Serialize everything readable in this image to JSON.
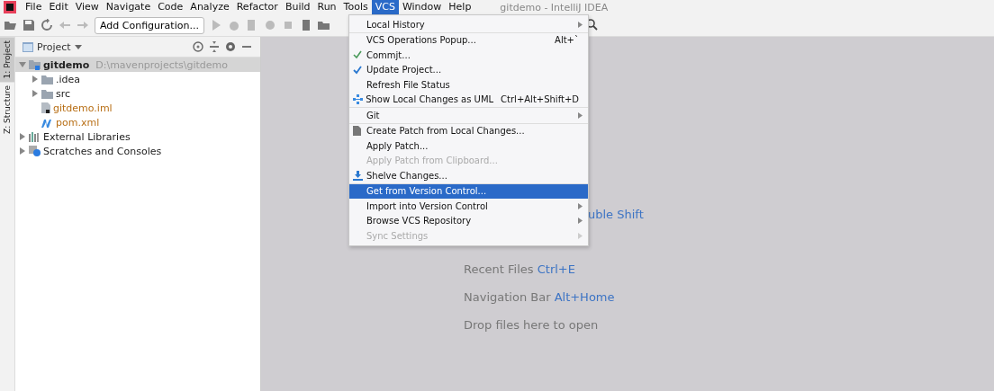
{
  "window": {
    "title": "gitdemo - IntelliJ IDEA"
  },
  "menubar": [
    {
      "label": "File",
      "selected": false
    },
    {
      "label": "Edit",
      "selected": false
    },
    {
      "label": "View",
      "selected": false
    },
    {
      "label": "Navigate",
      "selected": false
    },
    {
      "label": "Code",
      "selected": false
    },
    {
      "label": "Analyze",
      "selected": false
    },
    {
      "label": "Refactor",
      "selected": false
    },
    {
      "label": "Build",
      "selected": false
    },
    {
      "label": "Run",
      "selected": false
    },
    {
      "label": "Tools",
      "selected": false
    },
    {
      "label": "VCS",
      "selected": true
    },
    {
      "label": "Window",
      "selected": false
    },
    {
      "label": "Help",
      "selected": false
    }
  ],
  "toolbar": {
    "run_config": "Add Configuration..."
  },
  "side_tabs": [
    {
      "label": "1: Project",
      "selected": true
    },
    {
      "label": "Z: Structure",
      "selected": false
    }
  ],
  "project_panel": {
    "title": "Project",
    "tree": [
      {
        "label": "gitdemo",
        "path": "D:\\mavenprojects\\gitdemo",
        "expanded": true,
        "selected": true,
        "kind": "module",
        "children": [
          {
            "label": ".idea",
            "expanded": false,
            "selected": false,
            "kind": "folder"
          },
          {
            "label": "src",
            "expanded": false,
            "selected": false,
            "kind": "folder"
          },
          {
            "label": "gitdemo.iml",
            "selected": false,
            "kind": "iml"
          },
          {
            "label": "pom.xml",
            "selected": false,
            "kind": "maven"
          }
        ]
      },
      {
        "label": "External Libraries",
        "expanded": false,
        "selected": false,
        "kind": "libraries"
      },
      {
        "label": "Scratches and Consoles",
        "expanded": false,
        "selected": false,
        "kind": "scratches"
      }
    ]
  },
  "vcs_menu": [
    {
      "kind": "item",
      "label": "Local History",
      "submenu": true,
      "disabled": false,
      "selected": false
    },
    {
      "kind": "separator"
    },
    {
      "kind": "item",
      "label": "VCS Operations Popup...",
      "shortcut": "Alt+`",
      "submenu": false,
      "disabled": false,
      "selected": false
    },
    {
      "kind": "item",
      "label": "Commjt...",
      "submenu": false,
      "disabled": false,
      "selected": false
    },
    {
      "kind": "item",
      "label": "Update Project...",
      "submenu": false,
      "disabled": false,
      "selected": false
    },
    {
      "kind": "item",
      "label": "Refresh File Status",
      "submenu": false,
      "disabled": false,
      "selected": false
    },
    {
      "kind": "item",
      "label": "Show Local Changes as UML",
      "shortcut": "Ctrl+Alt+Shift+D",
      "submenu": false,
      "disabled": false,
      "selected": false
    },
    {
      "kind": "separator"
    },
    {
      "kind": "item",
      "label": "Git",
      "submenu": true,
      "disabled": false,
      "selected": false
    },
    {
      "kind": "separator"
    },
    {
      "kind": "item",
      "label": "Create Patch from Local Changes...",
      "submenu": false,
      "disabled": false,
      "selected": false
    },
    {
      "kind": "item",
      "label": "Apply Patch...",
      "submenu": false,
      "disabled": false,
      "selected": false
    },
    {
      "kind": "item",
      "label": "Apply Patch from Clipboard...",
      "submenu": false,
      "disabled": true,
      "selected": false
    },
    {
      "kind": "item",
      "label": "Shelve Changes...",
      "submenu": false,
      "disabled": false,
      "selected": false
    },
    {
      "kind": "separator"
    },
    {
      "kind": "item",
      "label": "Get from Version Control...",
      "submenu": false,
      "disabled": false,
      "selected": true
    },
    {
      "kind": "item",
      "label": "Import into Version Control",
      "submenu": true,
      "disabled": false,
      "selected": false
    },
    {
      "kind": "item",
      "label": "Browse VCS Repository",
      "submenu": true,
      "disabled": false,
      "selected": false
    },
    {
      "kind": "item",
      "label": "Sync Settings",
      "submenu": true,
      "disabled": true,
      "selected": false
    }
  ],
  "editor_hints": [
    {
      "shortcut": "uble Shift"
    },
    {
      "label": "Recent Files",
      "shortcut": "Ctrl+E"
    },
    {
      "label": "Navigation Bar",
      "shortcut": "Alt+Home"
    },
    {
      "label": "Drop files here to open"
    }
  ]
}
